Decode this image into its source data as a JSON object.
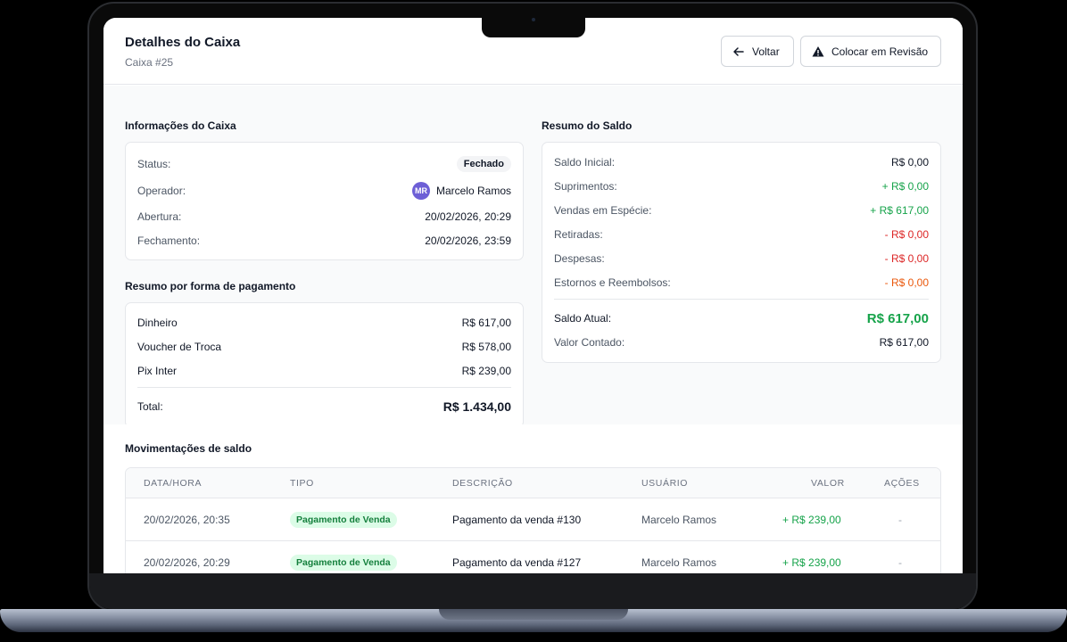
{
  "header": {
    "title": "Detalhes do Caixa",
    "subtitle": "Caixa #25",
    "back_label": "Voltar",
    "review_label": "Colocar em Revisão"
  },
  "info": {
    "title": "Informações do Caixa",
    "status_label": "Status:",
    "status_value": "Fechado",
    "operator_label": "Operador:",
    "operator_initials": "MR",
    "operator_name": "Marcelo Ramos",
    "open_label": "Abertura:",
    "open_value": "20/02/2026, 20:29",
    "close_label": "Fechamento:",
    "close_value": "20/02/2026, 23:59"
  },
  "payments": {
    "title": "Resumo por forma de pagamento",
    "items": [
      {
        "label": "Dinheiro",
        "value": "R$ 617,00"
      },
      {
        "label": "Voucher de Troca",
        "value": "R$ 578,00"
      },
      {
        "label": "Pix Inter",
        "value": "R$ 239,00"
      }
    ],
    "total_label": "Total:",
    "total_value": "R$ 1.434,00"
  },
  "balance": {
    "title": "Resumo do Saldo",
    "items": [
      {
        "label": "Saldo Inicial:",
        "value": "R$ 0,00"
      },
      {
        "label": "Suprimentos:",
        "value": "+ R$ 0,00"
      },
      {
        "label": "Vendas em Espécie:",
        "value": "+ R$ 617,00"
      },
      {
        "label": "Retiradas:",
        "value": "- R$ 0,00"
      },
      {
        "label": "Despesas:",
        "value": "- R$ 0,00"
      },
      {
        "label": "Estornos e Reembolsos:",
        "value": "- R$ 0,00"
      }
    ],
    "current_label": "Saldo Atual:",
    "current_value": "R$ 617,00",
    "counted_label": "Valor Contado:",
    "counted_value": "R$ 617,00"
  },
  "movements": {
    "title": "Movimentações de saldo",
    "columns": [
      "DATA/HORA",
      "TIPO",
      "DESCRIÇÃO",
      "USUÁRIO",
      "VALOR",
      "AÇÕES"
    ],
    "rows": [
      {
        "datetime": "20/02/2026, 20:35",
        "type": "Pagamento de Venda",
        "description": "Pagamento da venda #130",
        "user": "Marcelo Ramos",
        "value": "+ R$ 239,00",
        "actions": "-"
      },
      {
        "datetime": "20/02/2026, 20:29",
        "type": "Pagamento de Venda",
        "description": "Pagamento da venda #127",
        "user": "Marcelo Ramos",
        "value": "+ R$ 239,00",
        "actions": "-"
      }
    ]
  },
  "colors": {
    "positive": "#16a34a",
    "negative": "#dc2626",
    "refund": "#ea580c",
    "avatar": "#6d5fd6"
  },
  "icons": {
    "back": "arrow-left-icon",
    "review": "warning-triangle-icon"
  }
}
